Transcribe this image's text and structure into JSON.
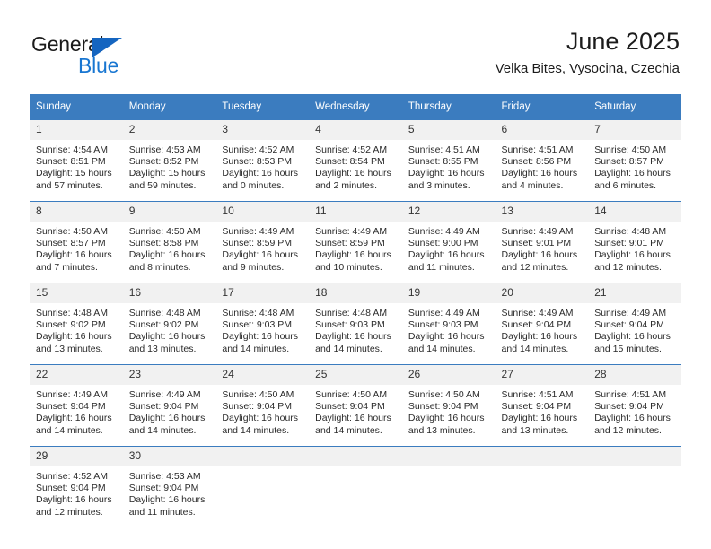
{
  "logo": {
    "word_top": "General",
    "word_bottom": "Blue",
    "triangle_color": "#1565c0",
    "blue_color": "#1876d1"
  },
  "header": {
    "title": "June 2025",
    "subtitle": "Velka Bites, Vysocina, Czechia"
  },
  "theme": {
    "header_row_bg": "#3b7cbf",
    "daynum_bg": "#f1f1f1",
    "grid_line": "#3b7cbf"
  },
  "weekday_headers": [
    "Sunday",
    "Monday",
    "Tuesday",
    "Wednesday",
    "Thursday",
    "Friday",
    "Saturday"
  ],
  "weeks": [
    [
      {
        "day": "1",
        "sunrise": "Sunrise: 4:54 AM",
        "sunset": "Sunset: 8:51 PM",
        "daylight1": "Daylight: 15 hours",
        "daylight2": "and 57 minutes."
      },
      {
        "day": "2",
        "sunrise": "Sunrise: 4:53 AM",
        "sunset": "Sunset: 8:52 PM",
        "daylight1": "Daylight: 15 hours",
        "daylight2": "and 59 minutes."
      },
      {
        "day": "3",
        "sunrise": "Sunrise: 4:52 AM",
        "sunset": "Sunset: 8:53 PM",
        "daylight1": "Daylight: 16 hours",
        "daylight2": "and 0 minutes."
      },
      {
        "day": "4",
        "sunrise": "Sunrise: 4:52 AM",
        "sunset": "Sunset: 8:54 PM",
        "daylight1": "Daylight: 16 hours",
        "daylight2": "and 2 minutes."
      },
      {
        "day": "5",
        "sunrise": "Sunrise: 4:51 AM",
        "sunset": "Sunset: 8:55 PM",
        "daylight1": "Daylight: 16 hours",
        "daylight2": "and 3 minutes."
      },
      {
        "day": "6",
        "sunrise": "Sunrise: 4:51 AM",
        "sunset": "Sunset: 8:56 PM",
        "daylight1": "Daylight: 16 hours",
        "daylight2": "and 4 minutes."
      },
      {
        "day": "7",
        "sunrise": "Sunrise: 4:50 AM",
        "sunset": "Sunset: 8:57 PM",
        "daylight1": "Daylight: 16 hours",
        "daylight2": "and 6 minutes."
      }
    ],
    [
      {
        "day": "8",
        "sunrise": "Sunrise: 4:50 AM",
        "sunset": "Sunset: 8:57 PM",
        "daylight1": "Daylight: 16 hours",
        "daylight2": "and 7 minutes."
      },
      {
        "day": "9",
        "sunrise": "Sunrise: 4:50 AM",
        "sunset": "Sunset: 8:58 PM",
        "daylight1": "Daylight: 16 hours",
        "daylight2": "and 8 minutes."
      },
      {
        "day": "10",
        "sunrise": "Sunrise: 4:49 AM",
        "sunset": "Sunset: 8:59 PM",
        "daylight1": "Daylight: 16 hours",
        "daylight2": "and 9 minutes."
      },
      {
        "day": "11",
        "sunrise": "Sunrise: 4:49 AM",
        "sunset": "Sunset: 8:59 PM",
        "daylight1": "Daylight: 16 hours",
        "daylight2": "and 10 minutes."
      },
      {
        "day": "12",
        "sunrise": "Sunrise: 4:49 AM",
        "sunset": "Sunset: 9:00 PM",
        "daylight1": "Daylight: 16 hours",
        "daylight2": "and 11 minutes."
      },
      {
        "day": "13",
        "sunrise": "Sunrise: 4:49 AM",
        "sunset": "Sunset: 9:01 PM",
        "daylight1": "Daylight: 16 hours",
        "daylight2": "and 12 minutes."
      },
      {
        "day": "14",
        "sunrise": "Sunrise: 4:48 AM",
        "sunset": "Sunset: 9:01 PM",
        "daylight1": "Daylight: 16 hours",
        "daylight2": "and 12 minutes."
      }
    ],
    [
      {
        "day": "15",
        "sunrise": "Sunrise: 4:48 AM",
        "sunset": "Sunset: 9:02 PM",
        "daylight1": "Daylight: 16 hours",
        "daylight2": "and 13 minutes."
      },
      {
        "day": "16",
        "sunrise": "Sunrise: 4:48 AM",
        "sunset": "Sunset: 9:02 PM",
        "daylight1": "Daylight: 16 hours",
        "daylight2": "and 13 minutes."
      },
      {
        "day": "17",
        "sunrise": "Sunrise: 4:48 AM",
        "sunset": "Sunset: 9:03 PM",
        "daylight1": "Daylight: 16 hours",
        "daylight2": "and 14 minutes."
      },
      {
        "day": "18",
        "sunrise": "Sunrise: 4:48 AM",
        "sunset": "Sunset: 9:03 PM",
        "daylight1": "Daylight: 16 hours",
        "daylight2": "and 14 minutes."
      },
      {
        "day": "19",
        "sunrise": "Sunrise: 4:49 AM",
        "sunset": "Sunset: 9:03 PM",
        "daylight1": "Daylight: 16 hours",
        "daylight2": "and 14 minutes."
      },
      {
        "day": "20",
        "sunrise": "Sunrise: 4:49 AM",
        "sunset": "Sunset: 9:04 PM",
        "daylight1": "Daylight: 16 hours",
        "daylight2": "and 14 minutes."
      },
      {
        "day": "21",
        "sunrise": "Sunrise: 4:49 AM",
        "sunset": "Sunset: 9:04 PM",
        "daylight1": "Daylight: 16 hours",
        "daylight2": "and 15 minutes."
      }
    ],
    [
      {
        "day": "22",
        "sunrise": "Sunrise: 4:49 AM",
        "sunset": "Sunset: 9:04 PM",
        "daylight1": "Daylight: 16 hours",
        "daylight2": "and 14 minutes."
      },
      {
        "day": "23",
        "sunrise": "Sunrise: 4:49 AM",
        "sunset": "Sunset: 9:04 PM",
        "daylight1": "Daylight: 16 hours",
        "daylight2": "and 14 minutes."
      },
      {
        "day": "24",
        "sunrise": "Sunrise: 4:50 AM",
        "sunset": "Sunset: 9:04 PM",
        "daylight1": "Daylight: 16 hours",
        "daylight2": "and 14 minutes."
      },
      {
        "day": "25",
        "sunrise": "Sunrise: 4:50 AM",
        "sunset": "Sunset: 9:04 PM",
        "daylight1": "Daylight: 16 hours",
        "daylight2": "and 14 minutes."
      },
      {
        "day": "26",
        "sunrise": "Sunrise: 4:50 AM",
        "sunset": "Sunset: 9:04 PM",
        "daylight1": "Daylight: 16 hours",
        "daylight2": "and 13 minutes."
      },
      {
        "day": "27",
        "sunrise": "Sunrise: 4:51 AM",
        "sunset": "Sunset: 9:04 PM",
        "daylight1": "Daylight: 16 hours",
        "daylight2": "and 13 minutes."
      },
      {
        "day": "28",
        "sunrise": "Sunrise: 4:51 AM",
        "sunset": "Sunset: 9:04 PM",
        "daylight1": "Daylight: 16 hours",
        "daylight2": "and 12 minutes."
      }
    ],
    [
      {
        "day": "29",
        "sunrise": "Sunrise: 4:52 AM",
        "sunset": "Sunset: 9:04 PM",
        "daylight1": "Daylight: 16 hours",
        "daylight2": "and 12 minutes."
      },
      {
        "day": "30",
        "sunrise": "Sunrise: 4:53 AM",
        "sunset": "Sunset: 9:04 PM",
        "daylight1": "Daylight: 16 hours",
        "daylight2": "and 11 minutes."
      },
      {
        "day": "",
        "sunrise": "",
        "sunset": "",
        "daylight1": "",
        "daylight2": ""
      },
      {
        "day": "",
        "sunrise": "",
        "sunset": "",
        "daylight1": "",
        "daylight2": ""
      },
      {
        "day": "",
        "sunrise": "",
        "sunset": "",
        "daylight1": "",
        "daylight2": ""
      },
      {
        "day": "",
        "sunrise": "",
        "sunset": "",
        "daylight1": "",
        "daylight2": ""
      },
      {
        "day": "",
        "sunrise": "",
        "sunset": "",
        "daylight1": "",
        "daylight2": ""
      }
    ]
  ]
}
